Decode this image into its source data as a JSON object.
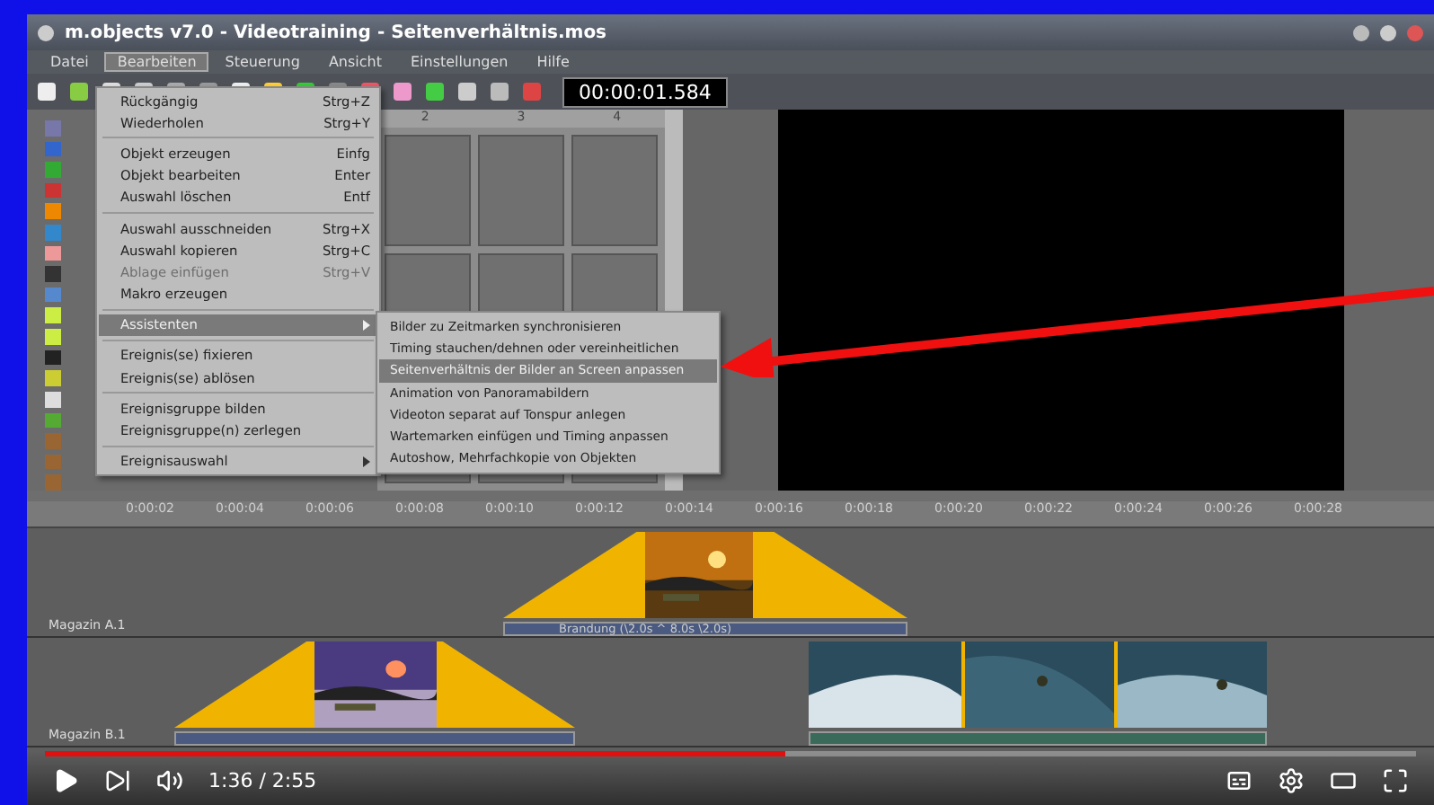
{
  "window": {
    "title": "m.objects v7.0 - Videotraining - Seitenverhältnis.mos"
  },
  "menu_bar": [
    {
      "label": "Datei",
      "selected": false
    },
    {
      "label": "Bearbeiten",
      "selected": true
    },
    {
      "label": "Steuerung",
      "selected": false
    },
    {
      "label": "Ansicht",
      "selected": false
    },
    {
      "label": "Einstellungen",
      "selected": false
    },
    {
      "label": "Hilfe",
      "selected": false
    }
  ],
  "time_display": "00:00:01.584",
  "thumbnail_columns": [
    "2",
    "3",
    "4"
  ],
  "edit_menu": [
    {
      "kind": "item",
      "label": "Rückgängig",
      "shortcut": "Strg+Z",
      "disabled": false,
      "selected": false
    },
    {
      "kind": "item",
      "label": "Wiederholen",
      "shortcut": "Strg+Y",
      "disabled": false,
      "selected": false
    },
    {
      "kind": "separator"
    },
    {
      "kind": "item",
      "label": "Objekt erzeugen",
      "shortcut": "Einfg",
      "disabled": false,
      "selected": false
    },
    {
      "kind": "item",
      "label": "Objekt bearbeiten",
      "shortcut": "Enter",
      "disabled": false,
      "selected": false
    },
    {
      "kind": "item",
      "label": "Auswahl löschen",
      "shortcut": "Entf",
      "disabled": false,
      "selected": false
    },
    {
      "kind": "separator"
    },
    {
      "kind": "item",
      "label": "Auswahl ausschneiden",
      "shortcut": "Strg+X",
      "disabled": false,
      "selected": false
    },
    {
      "kind": "item",
      "label": "Auswahl kopieren",
      "shortcut": "Strg+C",
      "disabled": false,
      "selected": false
    },
    {
      "kind": "item",
      "label": "Ablage einfügen",
      "shortcut": "Strg+V",
      "disabled": true,
      "selected": false
    },
    {
      "kind": "item",
      "label": "Makro erzeugen",
      "disabled": false,
      "selected": false
    },
    {
      "kind": "separator"
    },
    {
      "kind": "submenu",
      "label": "Assistenten",
      "disabled": false,
      "selected": true
    },
    {
      "kind": "separator"
    },
    {
      "kind": "item",
      "label": "Ereignis(se) fixieren",
      "disabled": false,
      "selected": false
    },
    {
      "kind": "item",
      "label": "Ereignis(se) ablösen",
      "disabled": false,
      "selected": false
    },
    {
      "kind": "separator"
    },
    {
      "kind": "item",
      "label": "Ereignisgruppe bilden",
      "disabled": false,
      "selected": false
    },
    {
      "kind": "item",
      "label": "Ereignisgruppe(n) zerlegen",
      "disabled": false,
      "selected": false
    },
    {
      "kind": "separator"
    },
    {
      "kind": "submenu",
      "label": "Ereignisauswahl",
      "disabled": false,
      "selected": false
    }
  ],
  "assistants_submenu": [
    {
      "label": "Bilder zu Zeitmarken synchronisieren",
      "selected": false
    },
    {
      "label": "Timing stauchen/dehnen oder vereinheitlichen",
      "selected": false
    },
    {
      "label": "Seitenverhältnis der Bilder an Screen anpassen",
      "selected": true
    },
    {
      "label": "Animation von Panoramabildern",
      "selected": false
    },
    {
      "label": "Videoton separat auf Tonspur anlegen",
      "selected": false
    },
    {
      "label": "Wartemarken einfügen und Timing anpassen",
      "selected": false
    },
    {
      "label": "Autoshow, Mehrfachkopie von Objekten",
      "selected": false
    }
  ],
  "timeline": {
    "ruler": [
      "0:00:02",
      "0:00:04",
      "0:00:06",
      "0:00:08",
      "0:00:10",
      "0:00:12",
      "0:00:14",
      "0:00:16",
      "0:00:18",
      "0:00:20",
      "0:00:22",
      "0:00:24",
      "0:00:26",
      "0:00:28"
    ],
    "tracks": [
      {
        "name": "Magazin A.1",
        "clips": [
          {
            "kind": "fade-picture",
            "label": "Brandung (\\2.0s ^ 8.0s \\2.0s)"
          }
        ]
      },
      {
        "name": "Magazin B.1",
        "clips": [
          {
            "kind": "fade-picture"
          },
          {
            "kind": "video"
          }
        ]
      }
    ]
  },
  "player": {
    "time": "1:36 / 2:55",
    "level": 0.54
  }
}
